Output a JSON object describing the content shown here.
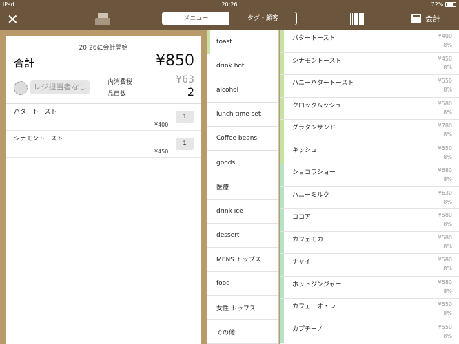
{
  "status": {
    "device": "iPad",
    "time": "20:26",
    "battery": "72%"
  },
  "toolbar": {
    "tabs": [
      {
        "label": "メニュー",
        "active": true
      },
      {
        "label": "タグ・顧客",
        "active": false
      }
    ],
    "checkout_label": "会計"
  },
  "receipt": {
    "start_text": "20:26に会計開始",
    "total_label": "合計",
    "total_amount": "¥850",
    "staff_button": "レジ担当者なし",
    "tax_label": "内消費税",
    "tax_value": "¥63",
    "count_label": "品目数",
    "count_value": "2",
    "items": [
      {
        "name": "バタートースト",
        "price": "¥400",
        "qty": "1"
      },
      {
        "name": "シナモントースト",
        "price": "¥450",
        "qty": "1"
      }
    ]
  },
  "categories": [
    "toast",
    "drink hot",
    "alcohol",
    "lunch time set",
    "Coffee beans",
    "goods",
    "医療",
    "drink ice",
    "dessert",
    "MENS トップス",
    "food",
    "女性 トップス",
    "その他"
  ],
  "selected_category": "toast",
  "products": [
    {
      "name": "バタートースト",
      "price": "¥400",
      "tax": "8%",
      "color": "#c6e3a4"
    },
    {
      "name": "シナモントースト",
      "price": "¥450",
      "tax": "8%",
      "color": "#c6e3a4"
    },
    {
      "name": "ハニーバタートースト",
      "price": "¥550",
      "tax": "8%",
      "color": "#c6e3a4"
    },
    {
      "name": "クロックムッシュ",
      "price": "¥580",
      "tax": "8%",
      "color": "#c6e3a4"
    },
    {
      "name": "グラタンサンド",
      "price": "¥780",
      "tax": "8%",
      "color": "#c6e3a4"
    },
    {
      "name": "キッシュ",
      "price": "¥550",
      "tax": "8%",
      "color": "#c6e3a4"
    },
    {
      "name": "ショコラショー",
      "price": "¥680",
      "tax": "8%",
      "color": "#b6e3c6"
    },
    {
      "name": "ハニーミルク",
      "price": "¥630",
      "tax": "8%",
      "color": "#b6e3c6"
    },
    {
      "name": "ココア",
      "price": "¥580",
      "tax": "8%",
      "color": "#b6e3c6"
    },
    {
      "name": "カフェモカ",
      "price": "¥580",
      "tax": "8%",
      "color": "#b6e3c6"
    },
    {
      "name": "チャイ",
      "price": "¥580",
      "tax": "8%",
      "color": "#b6e3c6"
    },
    {
      "name": "ホットジンジャー",
      "price": "¥580",
      "tax": "8%",
      "color": "#b6e3c6"
    },
    {
      "name": "カフェ　オ・レ",
      "price": "¥550",
      "tax": "8%",
      "color": "#b6e3c6"
    },
    {
      "name": "カプチーノ",
      "price": "¥550",
      "tax": "8%",
      "color": "#b6e3c6"
    }
  ]
}
